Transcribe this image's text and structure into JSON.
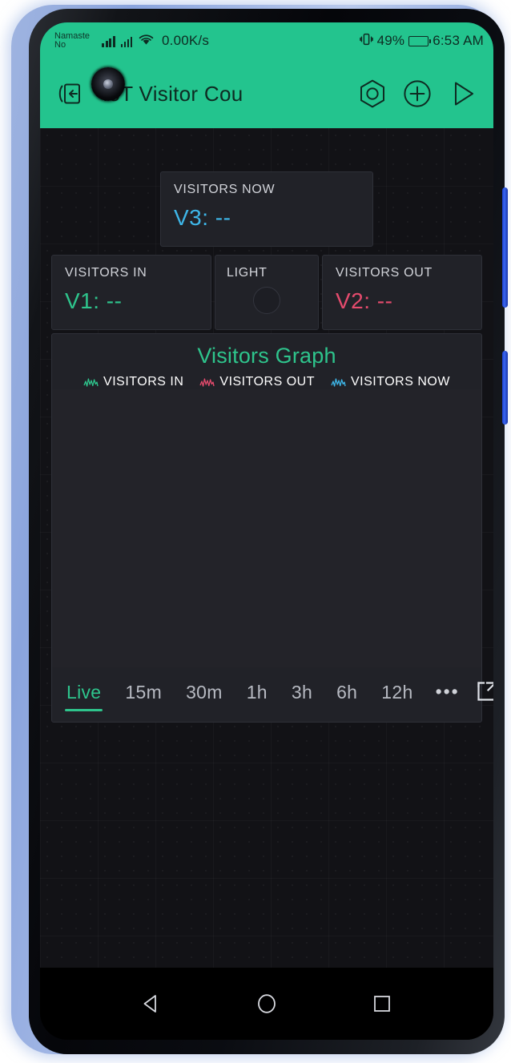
{
  "status_bar": {
    "notification_text": "Namaste No",
    "network_speed": "0.00K/s",
    "battery_percent": "49%",
    "clock": "6:53 AM",
    "icons": [
      "signal-icon",
      "signal-icon",
      "wifi-icon",
      "vibrate-icon",
      "battery-icon"
    ]
  },
  "app_bar": {
    "title": "IoT Visitor Cou",
    "back_icon": "exit-app-icon",
    "settings_icon": "hexagon-settings-icon",
    "add_icon": "plus-circle-icon",
    "play_icon": "play-triangle-icon",
    "background_color": "#23C48E"
  },
  "widgets": {
    "visitors_now": {
      "label": "VISITORS NOW",
      "value": "V3: --",
      "color": "#3EB6E8"
    },
    "visitors_in": {
      "label": "VISITORS IN",
      "value": "V1: --",
      "color": "#2EC48C"
    },
    "light": {
      "label": "LIGHT",
      "button_state": "off"
    },
    "visitors_out": {
      "label": "VISITORS OUT",
      "value": "V2: --",
      "color": "#E54B6D"
    }
  },
  "graph": {
    "title": "Visitors Graph",
    "legend": [
      {
        "label": "VISITORS IN",
        "color": "#2EC48C"
      },
      {
        "label": "VISITORS OUT",
        "color": "#E54B6D"
      },
      {
        "label": "VISITORS NOW",
        "color": "#3EB6E8"
      }
    ],
    "ranges": [
      {
        "label": "Live",
        "active": true
      },
      {
        "label": "15m",
        "active": false
      },
      {
        "label": "30m",
        "active": false
      },
      {
        "label": "1h",
        "active": false
      },
      {
        "label": "3h",
        "active": false
      },
      {
        "label": "6h",
        "active": false
      },
      {
        "label": "12h",
        "active": false
      }
    ],
    "more_label": "•••",
    "fullscreen_icon": "expand-external-icon"
  },
  "chart_data": {
    "type": "line",
    "title": "Visitors Graph",
    "series": [
      {
        "name": "VISITORS IN",
        "color": "#2EC48C",
        "values": []
      },
      {
        "name": "VISITORS OUT",
        "color": "#E54B6D",
        "values": []
      },
      {
        "name": "VISITORS NOW",
        "color": "#3EB6E8",
        "values": []
      }
    ],
    "x": [],
    "xlabel": "",
    "ylabel": "",
    "grid": false,
    "legend_position": "top",
    "selected_range": "Live",
    "note": "No data plotted — empty live chart"
  },
  "android_nav": {
    "back_icon": "back-triangle-icon",
    "home_icon": "home-circle-icon",
    "recents_icon": "recents-square-icon"
  }
}
